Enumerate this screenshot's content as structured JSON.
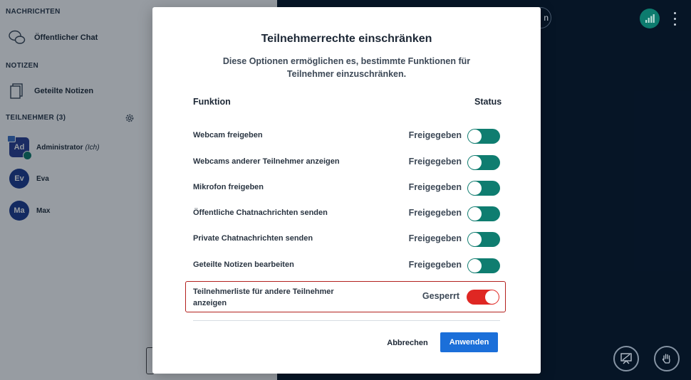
{
  "sidebar": {
    "messages_title": "NACHRICHTEN",
    "public_chat": "Öffentlicher Chat",
    "notes_title": "NOTIZEN",
    "shared_notes": "Geteilte Notizen",
    "participants_title": "TEILNEHMER (3)",
    "users": [
      {
        "initials": "Ad",
        "name": "Administrator",
        "you": "(Ich)"
      },
      {
        "initials": "Ev",
        "name": "Eva"
      },
      {
        "initials": "Ma",
        "name": "Max"
      }
    ]
  },
  "topbar": {
    "partial_button_text": "n"
  },
  "modal": {
    "title": "Teilnehmerrechte einschränken",
    "description": "Diese Optionen ermöglichen es, bestimmte Funktionen für Teilnehmer einzuschränken.",
    "col_function": "Funktion",
    "col_status": "Status",
    "rows": [
      {
        "label": "Webcam freigeben",
        "status": "Freigegeben"
      },
      {
        "label": "Webcams anderer Teilnehmer anzeigen",
        "status": "Freigegeben"
      },
      {
        "label": "Mikrofon freigeben",
        "status": "Freigegeben"
      },
      {
        "label": "Öffentliche Chatnachrichten senden",
        "status": "Freigegeben"
      },
      {
        "label": "Private Chatnachrichten senden",
        "status": "Freigegeben"
      },
      {
        "label": "Geteilte Notizen bearbeiten",
        "status": "Freigegeben"
      },
      {
        "label": "Teilnehmerliste für andere Teilnehmer anzeigen",
        "status": "Gesperrt"
      }
    ],
    "cancel_label": "Abbrechen",
    "apply_label": "Anwenden"
  },
  "colors": {
    "toggle_on": "#0f7d70",
    "toggle_locked": "#df2723",
    "apply_button": "#1b6fd9",
    "highlight_border": "#b3201d"
  }
}
